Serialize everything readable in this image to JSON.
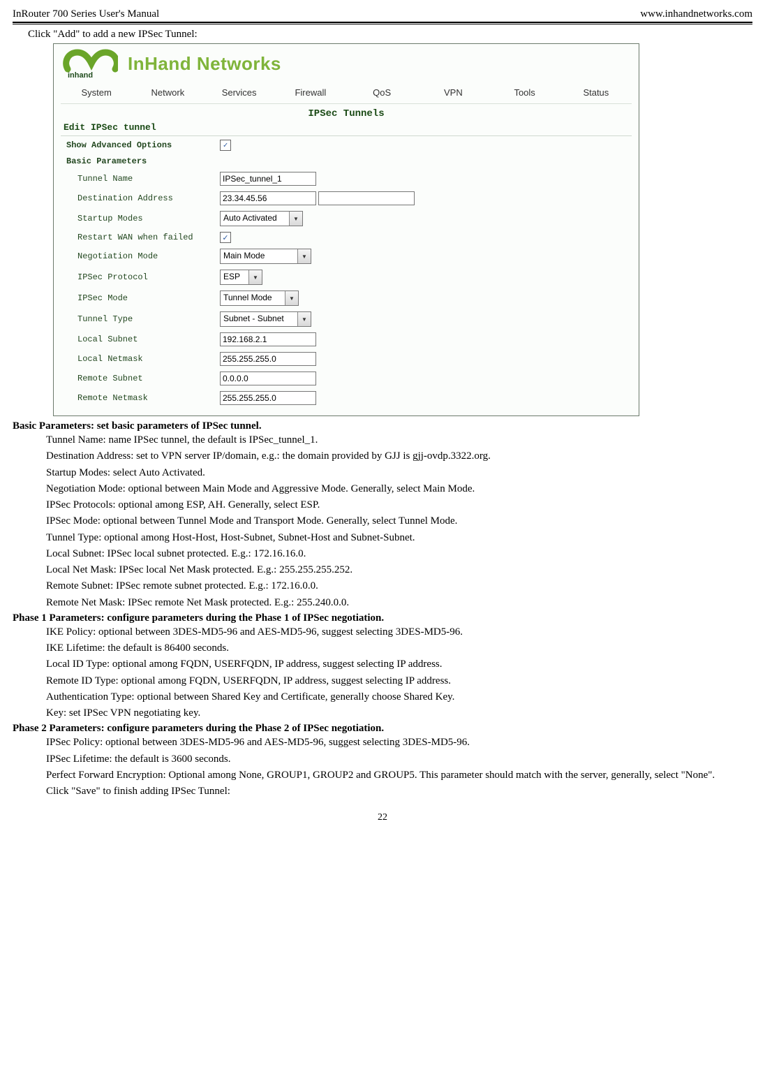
{
  "header": {
    "left": "InRouter 700 Series User's Manual",
    "right": "www.inhandnetworks.com"
  },
  "intro_line": "Click \"Add\" to add a new IPSec Tunnel:",
  "shot": {
    "brand": "InHand Networks",
    "nav": [
      "System",
      "Network",
      "Services",
      "Firewall",
      "QoS",
      "VPN",
      "Tools",
      "Status"
    ],
    "section_title": "IPSec Tunnels",
    "edit_title": "Edit IPSec tunnel",
    "headings": {
      "show_adv": "Show Advanced Options",
      "basic": "Basic Parameters"
    },
    "rows": {
      "tunnel_name": {
        "label": "Tunnel Name",
        "value": "IPSec_tunnel_1"
      },
      "dest_addr": {
        "label": "Destination Address",
        "value": "23.34.45.56"
      },
      "startup_modes": {
        "label": "Startup Modes",
        "value": "Auto Activated"
      },
      "restart_wan": {
        "label": "Restart WAN when failed"
      },
      "negotiation_mode": {
        "label": "Negotiation Mode",
        "value": "Main Mode"
      },
      "ipsec_protocol": {
        "label": "IPSec Protocol",
        "value": "ESP"
      },
      "ipsec_mode": {
        "label": "IPSec Mode",
        "value": "Tunnel Mode"
      },
      "tunnel_type": {
        "label": "Tunnel Type",
        "value": "Subnet - Subnet"
      },
      "local_subnet": {
        "label": "Local Subnet",
        "value": "192.168.2.1"
      },
      "local_netmask": {
        "label": "Local Netmask",
        "value": "255.255.255.0"
      },
      "remote_subnet": {
        "label": "Remote Subnet",
        "value": "0.0.0.0"
      },
      "remote_netmask": {
        "label": "Remote Netmask",
        "value": "255.255.255.0"
      }
    }
  },
  "body": {
    "h_basic": "Basic Parameters: set basic parameters of IPSec tunnel.",
    "basic": {
      "l1": "Tunnel Name: name IPSec tunnel, the default is IPSec_tunnel_1.",
      "l2": "Destination Address: set to VPN server IP/domain, e.g.: the domain provided by GJJ is gjj-ovdp.3322.org.",
      "l3": "Startup Modes: select Auto Activated.",
      "l4": "Negotiation Mode: optional between Main Mode and Aggressive Mode. Generally, select Main Mode.",
      "l5": "IPSec Protocols: optional among ESP, AH. Generally, select ESP.",
      "l6": "IPSec Mode: optional between Tunnel Mode and Transport Mode. Generally, select Tunnel Mode.",
      "l7": "Tunnel Type: optional among Host-Host, Host-Subnet, Subnet-Host and Subnet-Subnet.",
      "l8": "Local Subnet: IPSec local subnet protected. E.g.: 172.16.16.0.",
      "l9": "Local Net Mask: IPSec local Net Mask protected. E.g.: 255.255.255.252.",
      "l10": "Remote Subnet: IPSec remote subnet protected. E.g.: 172.16.0.0.",
      "l11": "Remote Net Mask: IPSec remote Net Mask protected. E.g.: 255.240.0.0."
    },
    "h_phase1": "Phase 1 Parameters: configure parameters during the Phase 1 of IPSec negotiation.",
    "phase1": {
      "l1": "IKE Policy: optional between 3DES-MD5-96 and AES-MD5-96, suggest selecting 3DES-MD5-96.",
      "l2": "IKE Lifetime: the default is 86400 seconds.",
      "l3": "Local ID Type: optional among FQDN, USERFQDN, IP address, suggest selecting IP address.",
      "l4": "Remote ID Type: optional among FQDN, USERFQDN, IP address, suggest selecting IP address.",
      "l5": "Authentication Type: optional between Shared Key and Certificate, generally choose Shared Key.",
      "l6": "Key: set IPSec VPN negotiating key."
    },
    "h_phase2": "Phase 2 Parameters: configure parameters during the Phase 2 of IPSec negotiation.",
    "phase2": {
      "l1": "IPSec Policy: optional between 3DES-MD5-96 and AES-MD5-96, suggest selecting 3DES-MD5-96.",
      "l2": "IPSec Lifetime: the default is 3600 seconds.",
      "l3": "Perfect Forward Encryption: Optional among None, GROUP1, GROUP2 and GROUP5. This parameter should match with the server, generally, select \"None\".",
      "l4": "Click \"Save\" to finish adding IPSec Tunnel:"
    }
  },
  "page_number": "22"
}
